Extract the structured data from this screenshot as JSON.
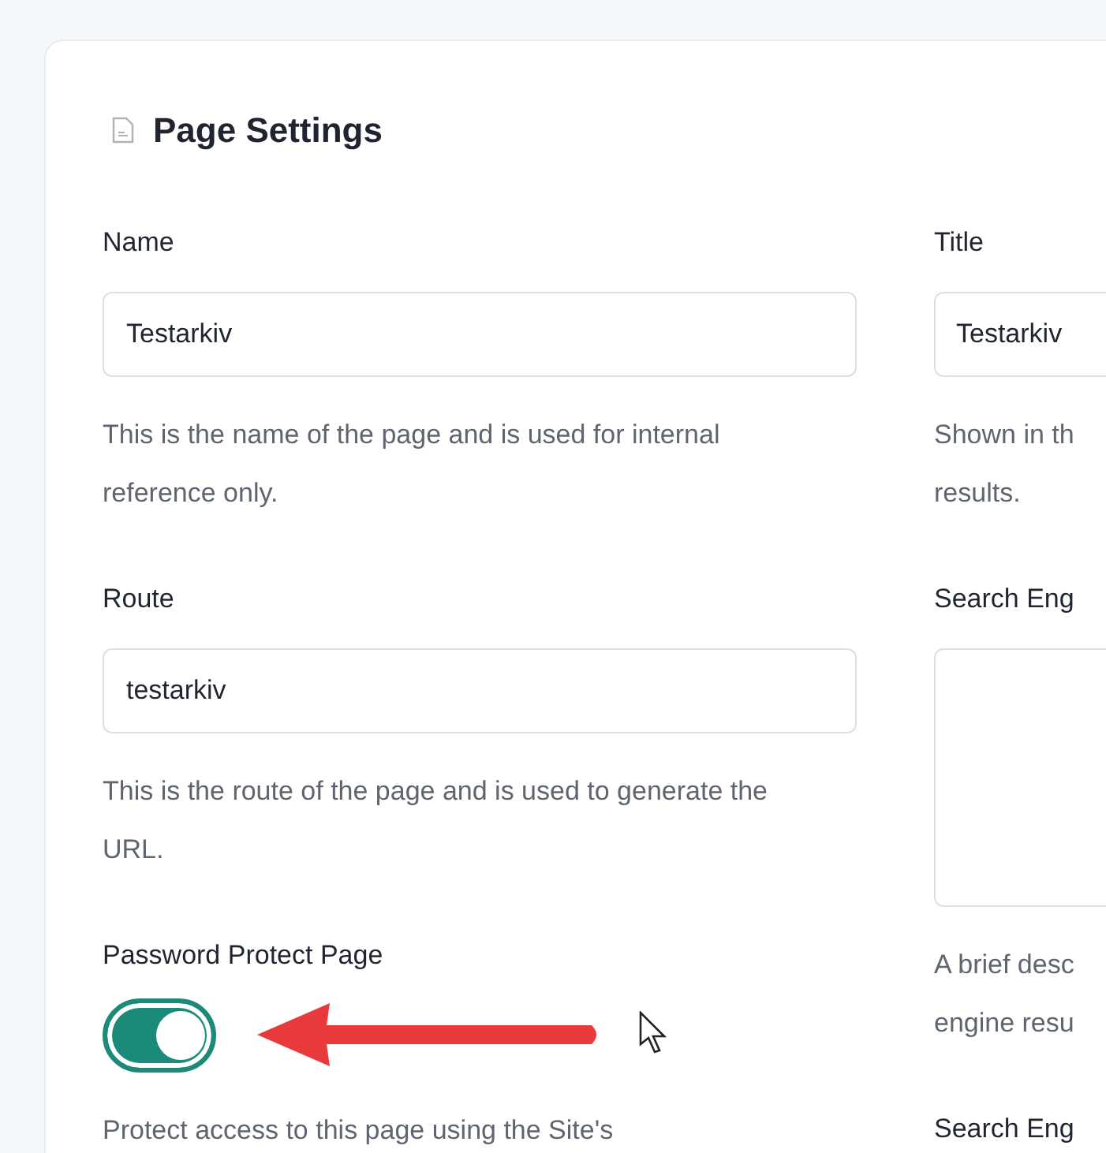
{
  "panel": {
    "title": "Page Settings"
  },
  "left_column": [
    {
      "kind": "input",
      "label": "Name",
      "value": "Testarkiv",
      "help": "This is the name of the page and is used for internal reference only."
    },
    {
      "kind": "input",
      "label": "Route",
      "value": "testarkiv",
      "help": "This is the route of the page and is used to generate the URL."
    },
    {
      "kind": "toggle",
      "label": "Password Protect Page",
      "on": true,
      "help": "Protect access to this page using the Site's"
    }
  ],
  "right_column": [
    {
      "kind": "input",
      "label": "Title",
      "value": "Testarkiv",
      "help_lines": [
        "Shown in th",
        "results."
      ]
    },
    {
      "kind": "textarea",
      "label": "Search Eng",
      "help_lines": [
        "A brief desc",
        "engine resu"
      ]
    },
    {
      "kind": "label",
      "label": "Search Eng"
    }
  ]
}
